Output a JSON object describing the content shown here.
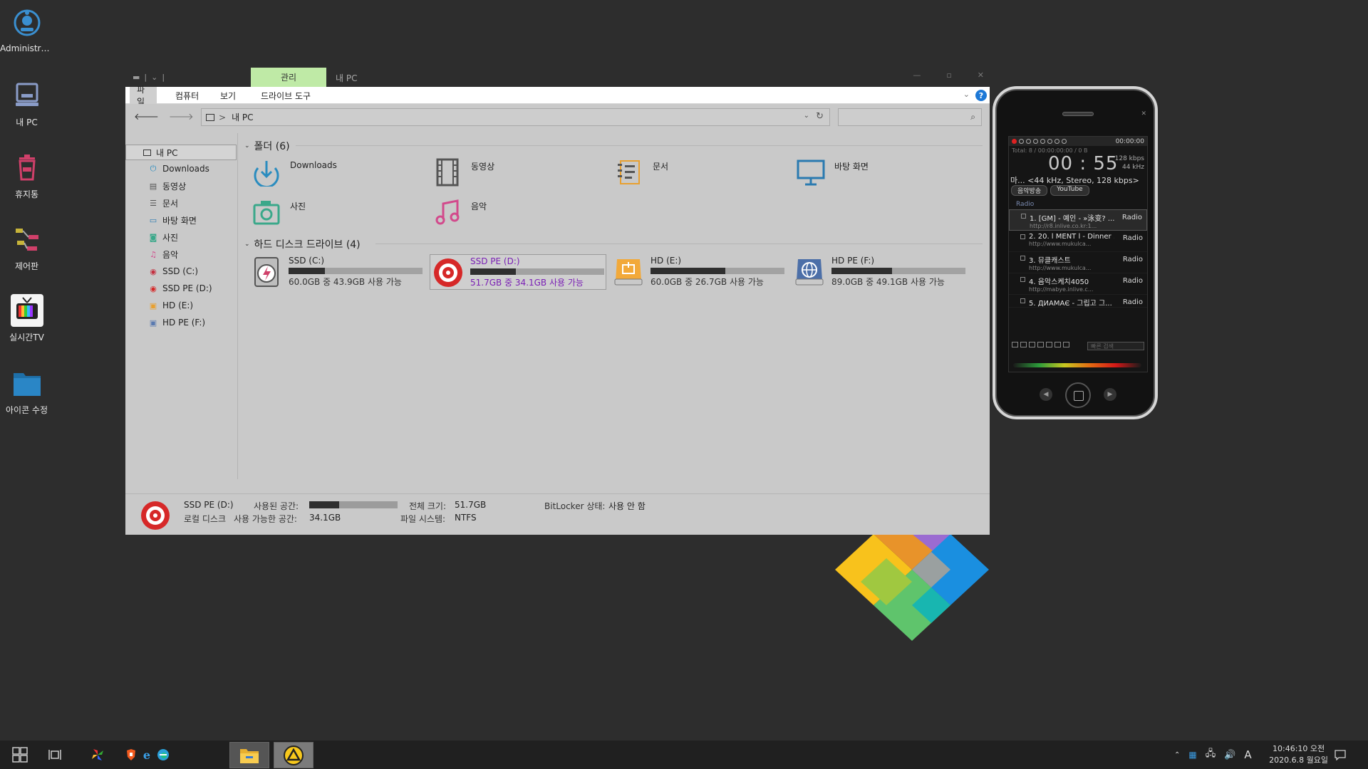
{
  "desktop": {
    "icons": [
      {
        "label": "Administra...",
        "icon": "user-folder-icon"
      },
      {
        "label": "내 PC",
        "icon": "computer-icon"
      },
      {
        "label": "휴지통",
        "icon": "recycle-bin-icon"
      },
      {
        "label": "제어판",
        "icon": "control-panel-icon"
      },
      {
        "label": "실시간TV",
        "icon": "tv-icon"
      },
      {
        "label": "아이콘 수정",
        "icon": "folder-icon"
      }
    ]
  },
  "explorer": {
    "window_title": "내 PC",
    "context_tab": "관리",
    "ribbon_tabs": [
      "파일",
      "컴퓨터",
      "보기",
      "드라이브 도구"
    ],
    "address": {
      "separator": ">",
      "path": "내 PC"
    },
    "search_placeholder": "",
    "nav_pane": [
      {
        "label": "내 PC",
        "icon": "computer-icon"
      },
      {
        "label": "Downloads",
        "icon": "download-icon"
      },
      {
        "label": "동영상",
        "icon": "video-icon"
      },
      {
        "label": "문서",
        "icon": "document-icon"
      },
      {
        "label": "바탕 화면",
        "icon": "desktop-icon"
      },
      {
        "label": "사진",
        "icon": "camera-icon"
      },
      {
        "label": "음악",
        "icon": "music-icon"
      },
      {
        "label": "SSD (C:)",
        "icon": "drive-icon"
      },
      {
        "label": "SSD PE (D:)",
        "icon": "drive-icon"
      },
      {
        "label": "HD (E:)",
        "icon": "drive-icon"
      },
      {
        "label": "HD PE (F:)",
        "icon": "drive-icon"
      }
    ],
    "folders_header": "폴더 (6)",
    "folders": [
      {
        "label": "Downloads",
        "icon": "download-icon"
      },
      {
        "label": "동영상",
        "icon": "video-icon"
      },
      {
        "label": "문서",
        "icon": "document-icon"
      },
      {
        "label": "바탕 화면",
        "icon": "desktop-icon"
      },
      {
        "label": "사진",
        "icon": "camera-icon"
      },
      {
        "label": "음악",
        "icon": "music-icon"
      }
    ],
    "drives_header": "하드 디스크 드라이브 (4)",
    "drives": [
      {
        "name": "SSD (C:)",
        "free_text": "60.0GB 중 43.9GB 사용 가능",
        "used_fraction": 0.27,
        "icon": "ssd-drive-icon"
      },
      {
        "name": "SSD PE (D:)",
        "free_text": "51.7GB 중 34.1GB 사용 가능",
        "used_fraction": 0.34,
        "icon": "pe-drive-icon"
      },
      {
        "name": "HD (E:)",
        "free_text": "60.0GB 중 26.7GB 사용 가능",
        "used_fraction": 0.56,
        "icon": "hdd-drive-icon"
      },
      {
        "name": "HD PE (F:)",
        "free_text": "89.0GB 중 49.1GB 사용 가능",
        "used_fraction": 0.45,
        "icon": "network-drive-icon"
      }
    ],
    "details": {
      "name": "SSD PE (D:)",
      "type": "로컬 디스크",
      "used_label": "사용된 공간:",
      "free_label": "사용 가능한 공간:",
      "free_value": "34.1GB",
      "used_fraction": 0.34,
      "total_label": "전체 크기:",
      "total_value": "51.7GB",
      "fs_label": "파일 시스템:",
      "fs_value": "NTFS",
      "bitlocker_label": "BitLocker 상태:",
      "bitlocker_value": "사용 안 함"
    }
  },
  "player": {
    "time_readout": "00:00:00",
    "total": "Total:   8   /   00:00:00:00   /   0 B",
    "elapsed": "00 : 55",
    "bitrate": "128 kbps",
    "samplerate": "44 kHz",
    "stream_info": "마... <44 kHz, Stereo, 128 kbps>",
    "tabs": [
      "음악방송",
      "YouTube"
    ],
    "group": "Radio",
    "items": [
      {
        "title": "1. [GM] - 예인 - »泳变? ...",
        "url": "http://r8.inlive.co.kr:1...",
        "genre": "Radio"
      },
      {
        "title": "2. 20. l MENT l - Dinner ...",
        "url": "http://www.mukulca...",
        "genre": "Radio"
      },
      {
        "title": "3. 뮤클캐스트",
        "url": "http://www.mukulca...",
        "genre": "Radio"
      },
      {
        "title": "4. 음악스케치4050",
        "url": "http://mabye.inlive.c...",
        "genre": "Radio"
      },
      {
        "title": "5. ДИАМАЄ - 그립고 그...",
        "url": "",
        "genre": "Radio"
      }
    ],
    "quick_search": "빠른 검색"
  },
  "taskbar": {
    "clock_time": "10:46:10 오전",
    "clock_date": "2020.6.8 월요일",
    "ime": "A"
  }
}
